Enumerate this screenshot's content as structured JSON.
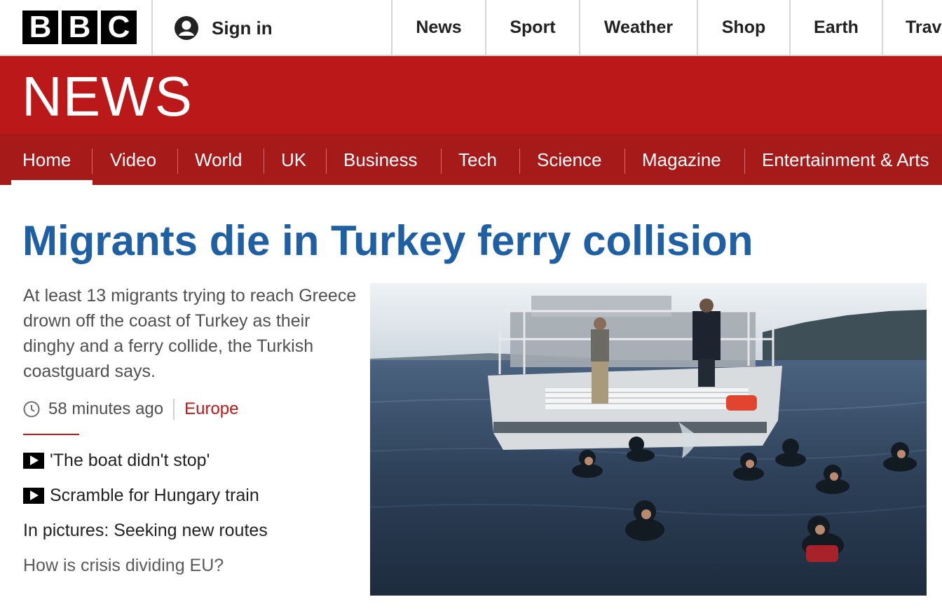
{
  "masthead": {
    "logo_letters": [
      "B",
      "B",
      "C"
    ],
    "sign_in": "Sign in",
    "nav": [
      "News",
      "Sport",
      "Weather",
      "Shop",
      "Earth",
      "Trav"
    ]
  },
  "news_band": {
    "wordmark": "NEWS"
  },
  "section_nav": {
    "items": [
      "Home",
      "Video",
      "World",
      "UK",
      "Business",
      "Tech",
      "Science",
      "Magazine",
      "Entertainment & Arts"
    ],
    "active": "Home"
  },
  "story": {
    "headline": "Migrants die in Turkey ferry collision",
    "summary": "At least 13 migrants trying to reach Greece drown off the coast of Turkey as their dinghy and a ferry collide, the Turkish coastguard says.",
    "timestamp": "58 minutes ago",
    "section": "Europe",
    "related": [
      {
        "label": "'The boat didn't stop'",
        "icon": "play-icon"
      },
      {
        "label": "Scramble for Hungary train",
        "icon": "play-icon"
      },
      {
        "label": "In pictures: Seeking new routes",
        "icon": ""
      },
      {
        "label": "How is crisis dividing EU?",
        "icon": ""
      }
    ]
  },
  "colors": {
    "news_red": "#bb1919",
    "nav_red": "#a71a1a",
    "headline_blue": "#1f5fa3"
  }
}
